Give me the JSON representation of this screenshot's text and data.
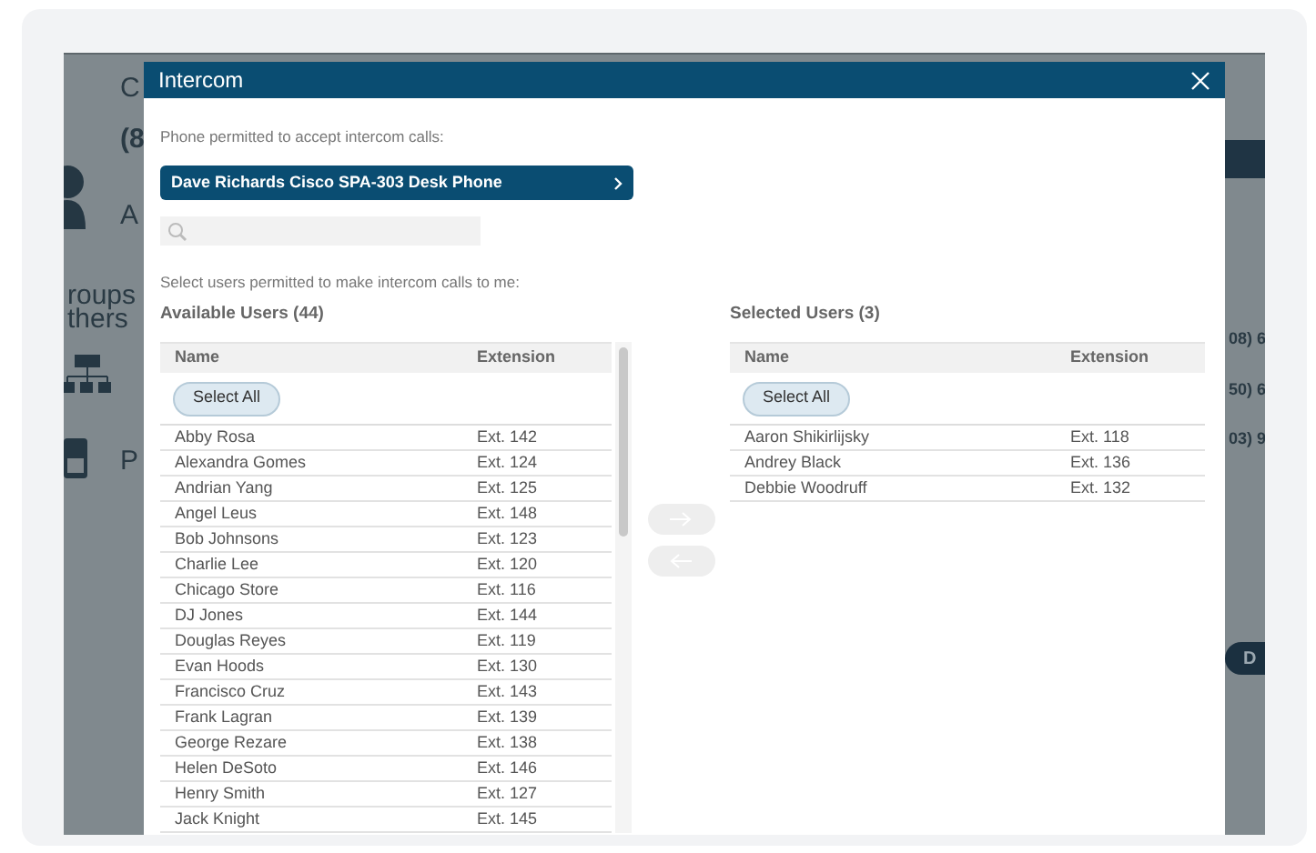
{
  "background": {
    "left_items": [
      {
        "kind": "text",
        "label": "C"
      },
      {
        "kind": "text",
        "label": "(8"
      },
      {
        "kind": "person",
        "label": "A"
      },
      {
        "kind": "text2",
        "label": "roups",
        "label2": "thers"
      },
      {
        "kind": "tree"
      },
      {
        "kind": "calc",
        "label": "P"
      }
    ],
    "right_items": [
      {
        "kind": "band"
      },
      {
        "kind": "text",
        "label": "08) 6"
      },
      {
        "kind": "text",
        "label": "50) 6"
      },
      {
        "kind": "text",
        "label": "03) 9"
      },
      {
        "kind": "button",
        "label": "D"
      }
    ]
  },
  "dialog": {
    "title": "Intercom",
    "phone_label": "Phone permitted to accept intercom calls:",
    "phone": "Dave Richards Cisco SPA-303 Desk Phone",
    "users_label": "Select users permitted to make intercom calls to me:",
    "available": {
      "title": "Available Users (44)",
      "columns": [
        "Name",
        "Extension"
      ],
      "select_all": "Select All",
      "rows": [
        [
          "Abby Rosa",
          "Ext. 142"
        ],
        [
          "Alexandra Gomes",
          "Ext. 124"
        ],
        [
          "Andrian Yang",
          "Ext. 125"
        ],
        [
          "Angel Leus",
          "Ext. 148"
        ],
        [
          "Bob Johnsons",
          "Ext. 123"
        ],
        [
          "Charlie Lee",
          "Ext. 120"
        ],
        [
          "Chicago Store",
          "Ext. 116"
        ],
        [
          "DJ Jones",
          "Ext. 144"
        ],
        [
          "Douglas Reyes",
          "Ext. 119"
        ],
        [
          "Evan Hoods",
          "Ext. 130"
        ],
        [
          "Francisco Cruz",
          "Ext. 143"
        ],
        [
          "Frank Lagran",
          "Ext. 139"
        ],
        [
          "George Rezare",
          "Ext. 138"
        ],
        [
          "Helen DeSoto",
          "Ext. 146"
        ],
        [
          "Henry Smith",
          "Ext. 127"
        ],
        [
          "Jack Knight",
          "Ext. 145"
        ]
      ]
    },
    "move_buttons": [
      {
        "kind": "right",
        "disabled": true
      },
      {
        "kind": "left",
        "disabled": true
      }
    ],
    "selected": {
      "title": "Selected Users (3)",
      "columns": [
        "Name",
        "Extension"
      ],
      "select_all": "Select All",
      "rows": [
        [
          "Aaron Shikirlijsky",
          "Ext. 118"
        ],
        [
          "Andrey Black",
          "Ext. 136"
        ],
        [
          "Debbie Woodruff",
          "Ext. 132"
        ]
      ]
    }
  }
}
